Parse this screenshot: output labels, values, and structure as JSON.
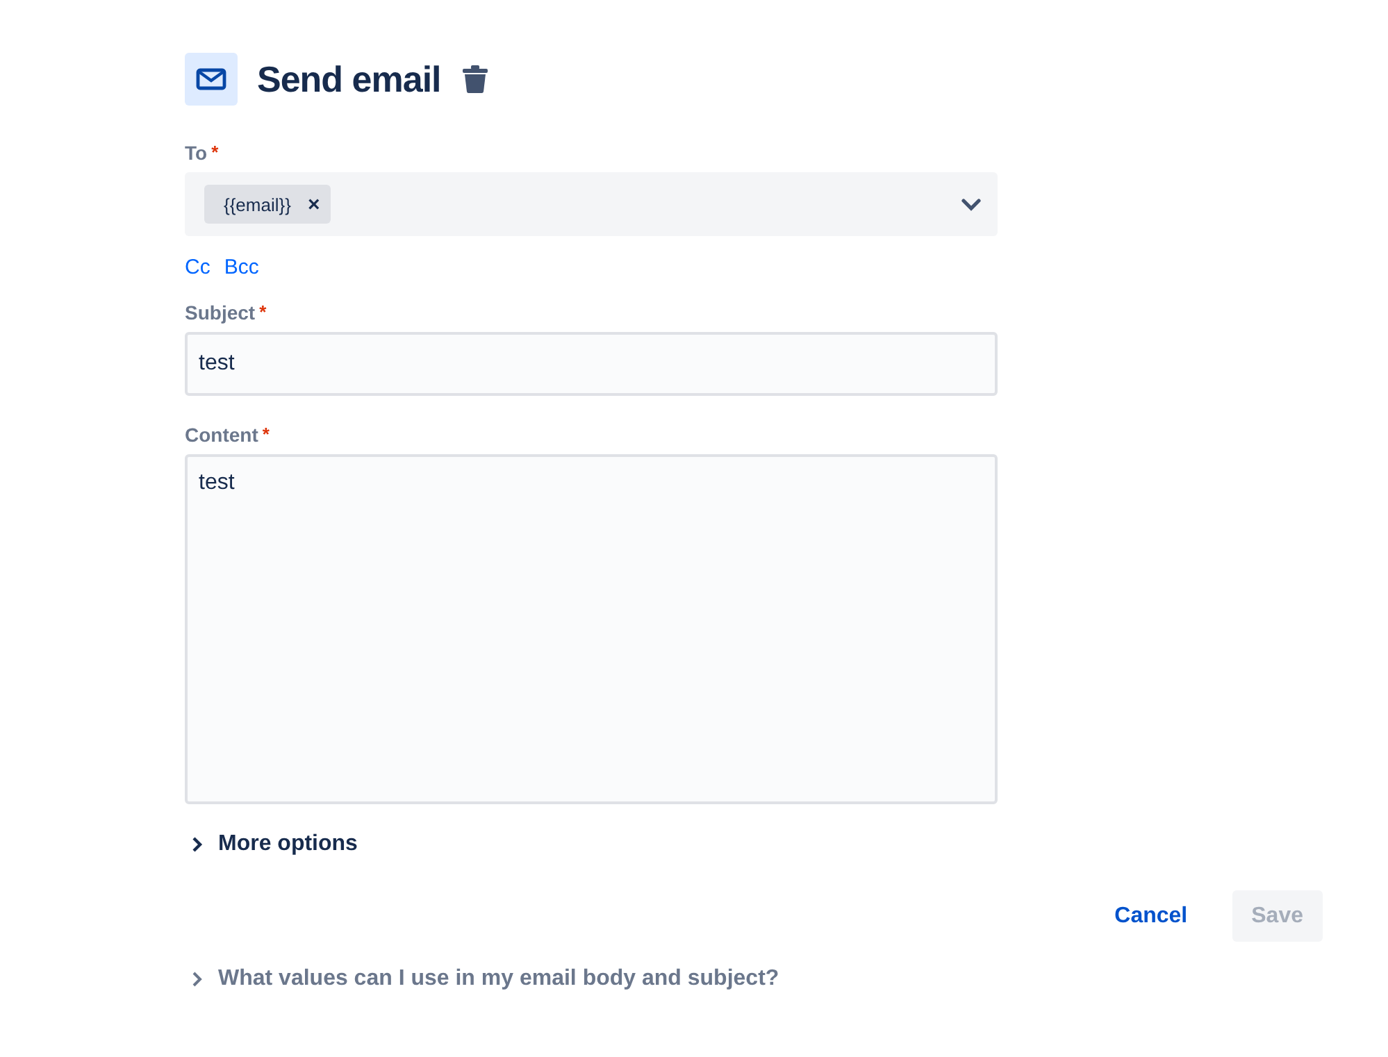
{
  "header": {
    "title": "Send email"
  },
  "to": {
    "label": "To",
    "required_mark": "*",
    "tags": [
      {
        "label": "{{email}}",
        "remove": "×"
      }
    ]
  },
  "recipient_links": [
    {
      "label": "Cc"
    },
    {
      "label": "Bcc"
    }
  ],
  "subject": {
    "label": "Subject",
    "required_mark": "*",
    "value": "test"
  },
  "content": {
    "label": "Content",
    "required_mark": "*",
    "value": "test"
  },
  "more_options": {
    "label": "More options",
    "expanded": false
  },
  "buttons": [
    {
      "label": "Cancel",
      "kind": "link",
      "disabled": false
    },
    {
      "label": "Save",
      "kind": "primary",
      "disabled": true
    }
  ],
  "help": {
    "label": "What values can I use in my email body and subject?",
    "expanded": false
  }
}
